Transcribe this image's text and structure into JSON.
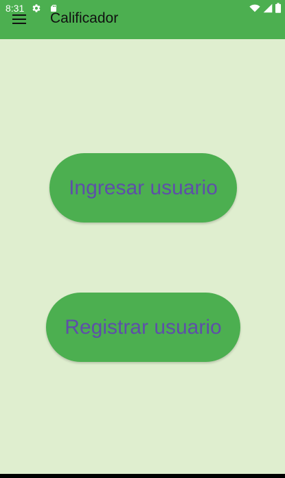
{
  "status_bar": {
    "time": "8:31",
    "icons": [
      "settings-icon",
      "sd-card-icon",
      "wifi-icon",
      "signal-icon",
      "battery-icon"
    ]
  },
  "app_bar": {
    "title": "Calificador",
    "menu_icon": "hamburger-menu-icon"
  },
  "buttons": {
    "login": "Ingresar usuario",
    "register": "Registrar usuario"
  },
  "colors": {
    "background": "#dfeecf",
    "app_bar": "#4caf50",
    "button": "#4caf50",
    "button_text": "#5e4fa9",
    "title_text": "#111111"
  }
}
